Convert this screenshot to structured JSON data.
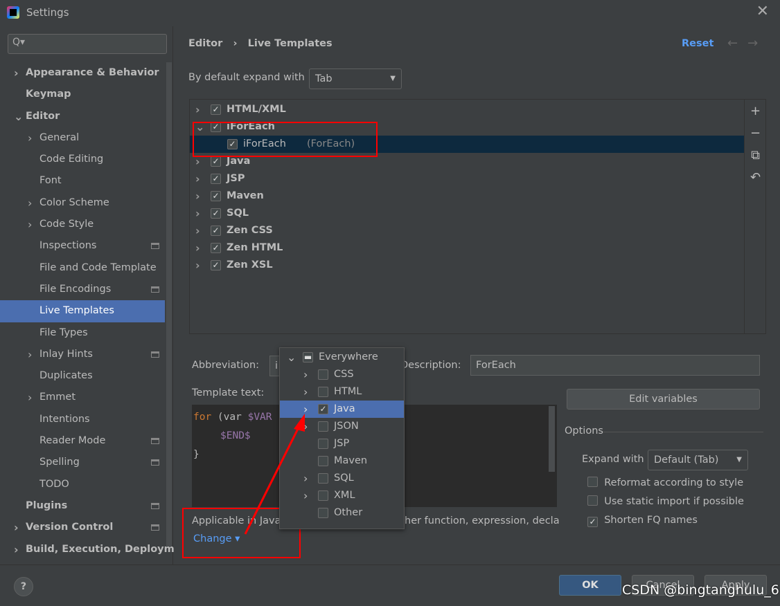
{
  "window": {
    "title": "Settings",
    "close_icon": "close-icon"
  },
  "sidebar": {
    "search_placeholder": "Q▾",
    "items": [
      {
        "label": "Appearance & Behavior",
        "level": 0,
        "bold": true,
        "expandable": true
      },
      {
        "label": "Keymap",
        "level": 0,
        "bold": true
      },
      {
        "label": "Editor",
        "level": 0,
        "bold": true,
        "expanded": true
      },
      {
        "label": "General",
        "level": 1,
        "expandable": true
      },
      {
        "label": "Code Editing",
        "level": 1
      },
      {
        "label": "Font",
        "level": 1
      },
      {
        "label": "Color Scheme",
        "level": 1,
        "expandable": true
      },
      {
        "label": "Code Style",
        "level": 1,
        "expandable": true
      },
      {
        "label": "Inspections",
        "level": 1,
        "badge": true
      },
      {
        "label": "File and Code Template",
        "level": 1
      },
      {
        "label": "File Encodings",
        "level": 1,
        "badge": true
      },
      {
        "label": "Live Templates",
        "level": 1,
        "selected": true
      },
      {
        "label": "File Types",
        "level": 1
      },
      {
        "label": "Inlay Hints",
        "level": 1,
        "expandable": true,
        "badge": true
      },
      {
        "label": "Duplicates",
        "level": 1
      },
      {
        "label": "Emmet",
        "level": 1,
        "expandable": true
      },
      {
        "label": "Intentions",
        "level": 1
      },
      {
        "label": "Reader Mode",
        "level": 1,
        "badge": true
      },
      {
        "label": "Spelling",
        "level": 1,
        "badge": true
      },
      {
        "label": "TODO",
        "level": 1
      },
      {
        "label": "Plugins",
        "level": 0,
        "bold": true,
        "badge": true
      },
      {
        "label": "Version Control",
        "level": 0,
        "bold": true,
        "expandable": true,
        "badge": true
      },
      {
        "label": "Build, Execution, Deploym",
        "level": 0,
        "bold": true,
        "expandable": true
      }
    ]
  },
  "header": {
    "breadcrumb": [
      "Editor",
      "Live Templates"
    ],
    "separator": "›",
    "reset": "Reset",
    "back": "←",
    "forward": "→"
  },
  "expand": {
    "label": "By default expand with",
    "value": "Tab"
  },
  "tree": [
    {
      "label": "HTML/XML",
      "checked": true,
      "chevron": "›"
    },
    {
      "label": "iForEach",
      "checked": true,
      "chevron": "⌄"
    },
    {
      "label": "iForEach",
      "sub": "(ForEach)",
      "checked": true,
      "child": true,
      "selected": true
    },
    {
      "label": "Java",
      "checked": true,
      "chevron": "›"
    },
    {
      "label": "JSP",
      "checked": true,
      "chevron": "›"
    },
    {
      "label": "Maven",
      "checked": true,
      "chevron": "›"
    },
    {
      "label": "SQL",
      "checked": true,
      "chevron": "›"
    },
    {
      "label": "Zen CSS",
      "checked": true,
      "chevron": "›"
    },
    {
      "label": "Zen HTML",
      "checked": true,
      "chevron": "›"
    },
    {
      "label": "Zen XSL",
      "checked": true,
      "chevron": "›"
    }
  ],
  "tools": [
    "+",
    "−",
    "⧉",
    "↶"
  ],
  "form": {
    "abbreviation_label": "Abbreviation:",
    "abbreviation_value": "i",
    "description_label": "Description:",
    "description_value": "ForEach",
    "template_label": "Template text:",
    "edit_variables": "Edit variables",
    "code": {
      "l1a": "for",
      "l1b": " (var ",
      "l1c": "$VAR",
      "l1d": "$){",
      "l1e": "$",
      "l2": "$END$",
      "l3": "}"
    },
    "applicable_left": "Applicable in Java",
    "applicable_right": "her function, expression, decla",
    "change": "Change ▾"
  },
  "options": {
    "title": "Options",
    "expand_label": "Expand with",
    "expand_value": "Default (Tab)",
    "reformat": "Reformat according to style",
    "static_import": "Use static import if possible",
    "shorten": "Shorten FQ names",
    "reformat_checked": false,
    "static_checked": false,
    "shorten_checked": true
  },
  "popup": [
    {
      "label": "Everywhere",
      "state": "partial",
      "chevron": "⌄",
      "level": 0
    },
    {
      "label": "CSS",
      "chevron": "›"
    },
    {
      "label": "HTML",
      "chevron": "›"
    },
    {
      "label": "Java",
      "chevron": "›",
      "checked": true,
      "selected": true
    },
    {
      "label": "JSON",
      "chevron": "›"
    },
    {
      "label": "JSP"
    },
    {
      "label": "Maven"
    },
    {
      "label": "SQL",
      "chevron": "›"
    },
    {
      "label": "XML",
      "chevron": "›"
    },
    {
      "label": "Other"
    }
  ],
  "footer": {
    "help": "?",
    "ok": "OK",
    "cancel": "Cancel",
    "apply": "Apply",
    "watermark": "CSDN @bingtanghulu_6"
  },
  "colors": {
    "accent": "#4b6eaf",
    "link": "#589df6",
    "annotation": "#ff0000",
    "bg": "#3c3f41"
  }
}
